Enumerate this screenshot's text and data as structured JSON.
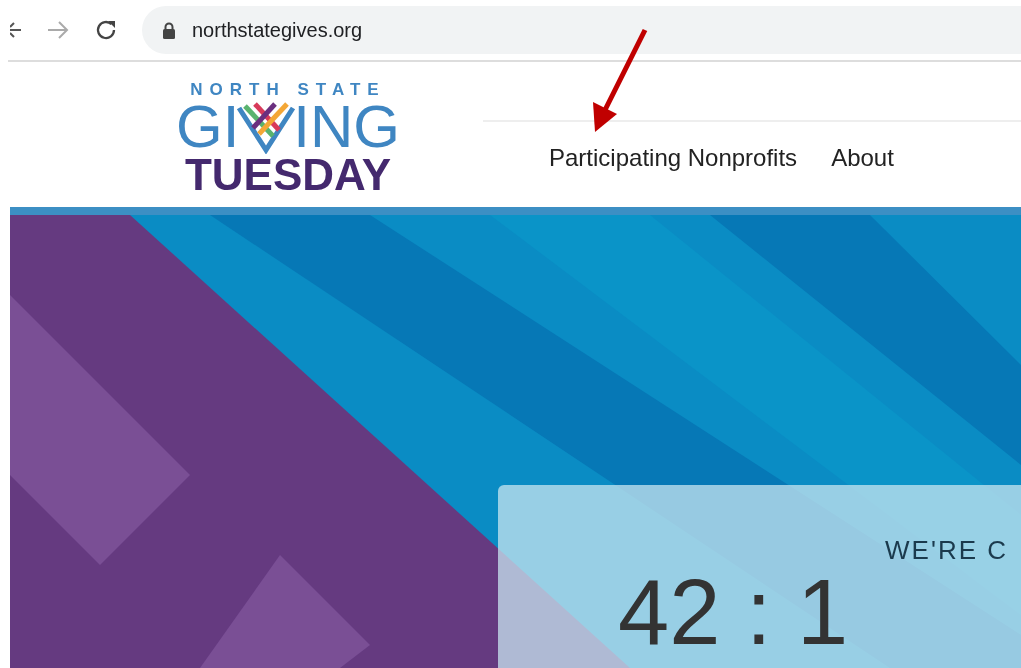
{
  "browser": {
    "back_disabled": false,
    "forward_disabled": true,
    "url": "northstategives.org"
  },
  "logo": {
    "top": "NORTH STATE",
    "left": "GI",
    "right": "ING",
    "bottom": "TUESDAY"
  },
  "nav": [
    {
      "label": "Participating Nonprofits"
    },
    {
      "label": "About"
    }
  ],
  "countdown": {
    "heading": "WE'RE C",
    "time": "42 : 1"
  }
}
